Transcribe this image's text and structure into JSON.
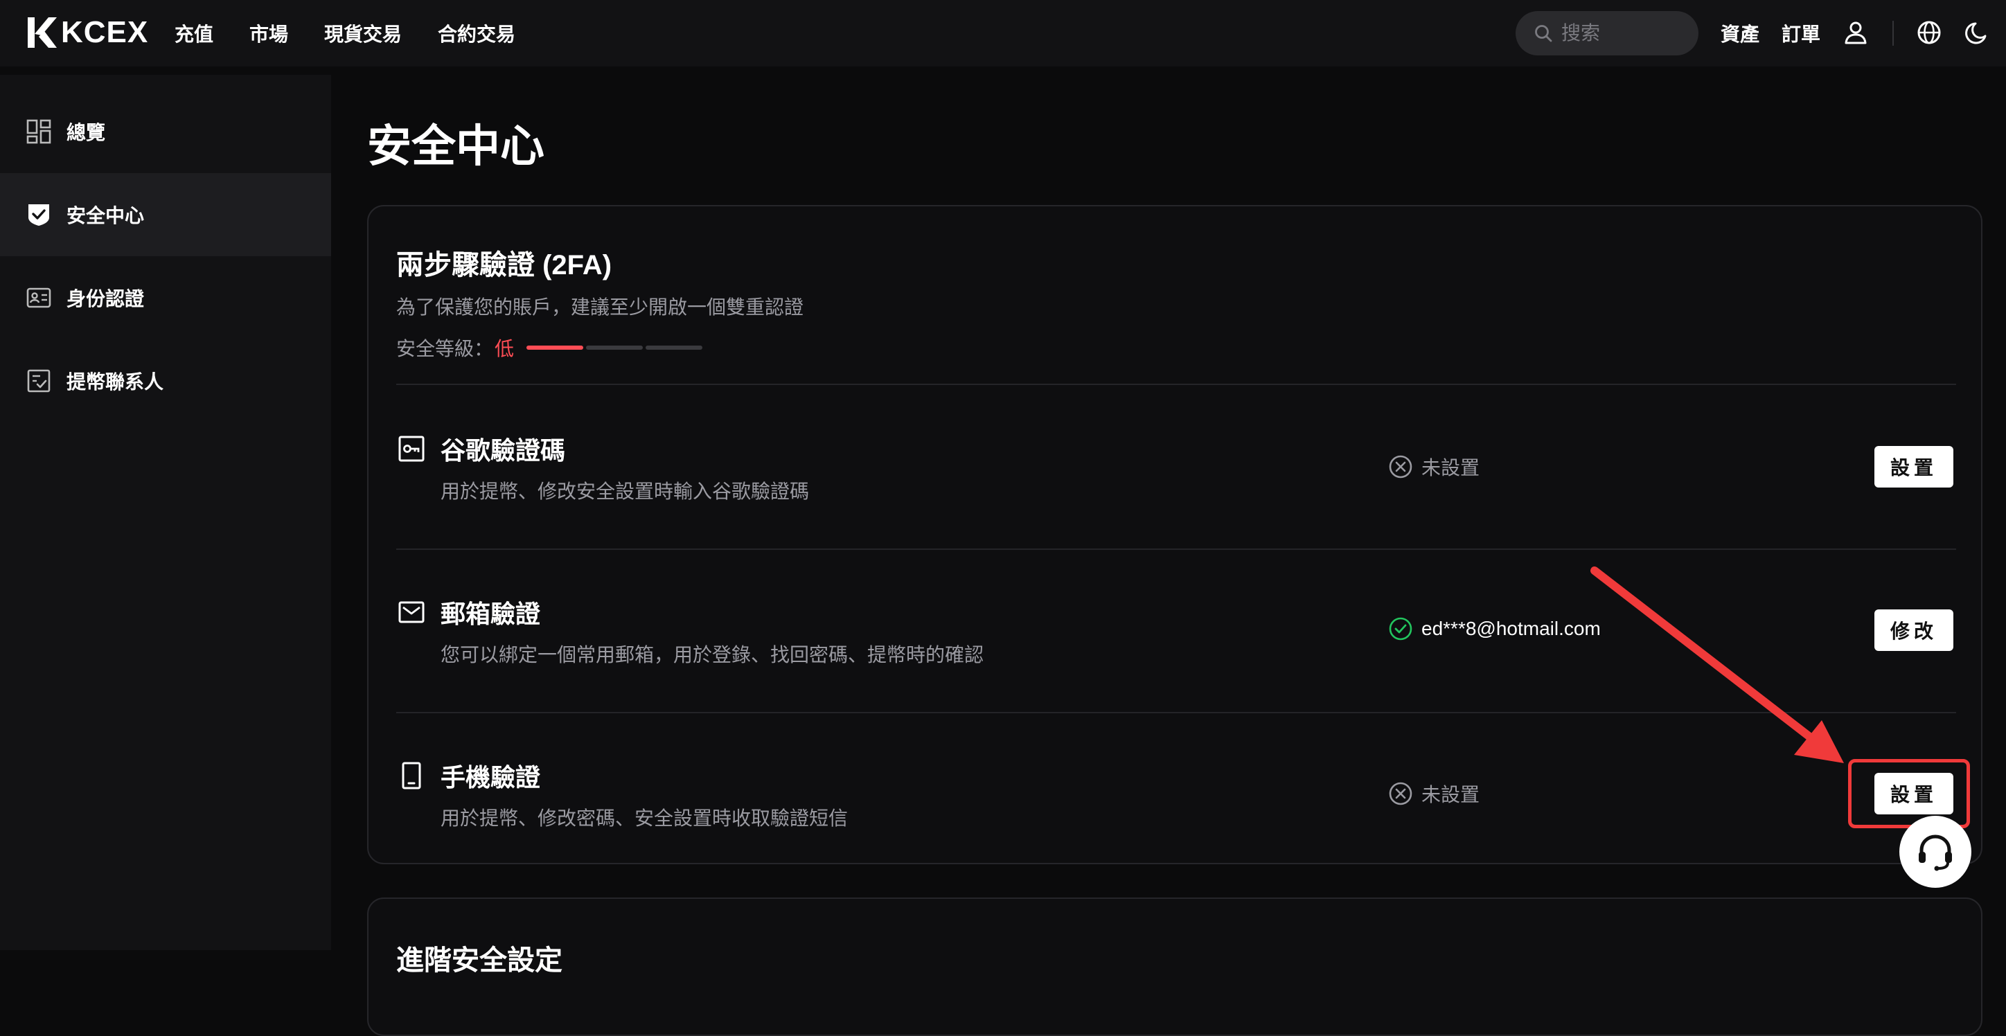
{
  "header": {
    "logo_text": "KCEX",
    "nav": [
      "充值",
      "市場",
      "現貨交易",
      "合約交易"
    ],
    "search": {
      "placeholder": "搜索",
      "value": ""
    },
    "assets_label": "資產",
    "orders_label": "訂單",
    "icons": [
      "user-icon",
      "globe-icon",
      "moon-icon"
    ]
  },
  "sidebar": {
    "items": [
      {
        "label": "總覽",
        "icon": "dashboard-icon",
        "active": false
      },
      {
        "label": "安全中心",
        "icon": "shield-check-icon",
        "active": true
      },
      {
        "label": "身份認證",
        "icon": "id-card-icon",
        "active": false
      },
      {
        "label": "提幣聯系人",
        "icon": "contact-list-icon",
        "active": false
      }
    ]
  },
  "main": {
    "page_title": "安全中心",
    "twofa": {
      "title": "兩步驟驗證 (2FA)",
      "description": "為了保護您的賬戶，建議至少開啟一個雙重認證",
      "level_label": "安全等級：",
      "level_value": "低",
      "level_filled": 1,
      "level_total": 3,
      "items": [
        {
          "title": "谷歌驗證碼",
          "description": "用於提幣、修改安全設置時輸入谷歌驗證碼",
          "status": "未設置",
          "status_state": "not-set",
          "button": "設置",
          "icon": "key-icon"
        },
        {
          "title": "郵箱驗證",
          "description": "您可以綁定一個常用郵箱，用於登錄、找回密碼、提幣時的確認",
          "status": "ed***8@hotmail.com",
          "status_state": "set",
          "button": "修改",
          "icon": "mail-icon"
        },
        {
          "title": "手機驗證",
          "description": "用於提幣、修改密碼、安全設置時收取驗證短信",
          "status": "未設置",
          "status_state": "not-set",
          "button": "設置",
          "icon": "phone-icon"
        }
      ]
    },
    "advanced": {
      "title": "進階安全設定"
    }
  },
  "colors": {
    "background": "#0b0b0c",
    "panel": "#121214",
    "danger": "#ff4d55",
    "success": "#22c55e",
    "annotation": "#f03a3a"
  }
}
